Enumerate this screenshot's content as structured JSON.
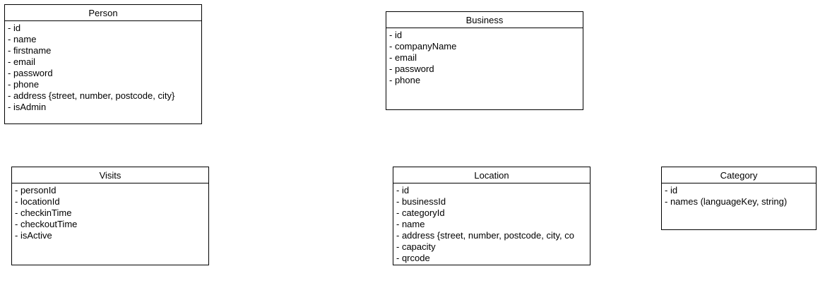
{
  "classes": {
    "person": {
      "name": "Person",
      "attributes": [
        "- id",
        "- name",
        "- firstname",
        "- email",
        "- password",
        "- phone",
        "- address {street, number, postcode, city}",
        "- isAdmin"
      ]
    },
    "business": {
      "name": "Business",
      "attributes": [
        "- id",
        "- companyName",
        "- email",
        "- password",
        "- phone"
      ]
    },
    "visits": {
      "name": "Visits",
      "attributes": [
        "- personId",
        "- locationId",
        "- checkinTime",
        "- checkoutTime",
        "- isActive"
      ]
    },
    "location": {
      "name": "Location",
      "attributes": [
        "- id",
        "- businessId",
        "- categoryId",
        "- name",
        "- address {street, number, postcode, city, co",
        "- capacity",
        "- qrcode"
      ]
    },
    "category": {
      "name": "Category",
      "attributes": [
        "- id",
        "- names (languageKey, string)"
      ]
    }
  }
}
